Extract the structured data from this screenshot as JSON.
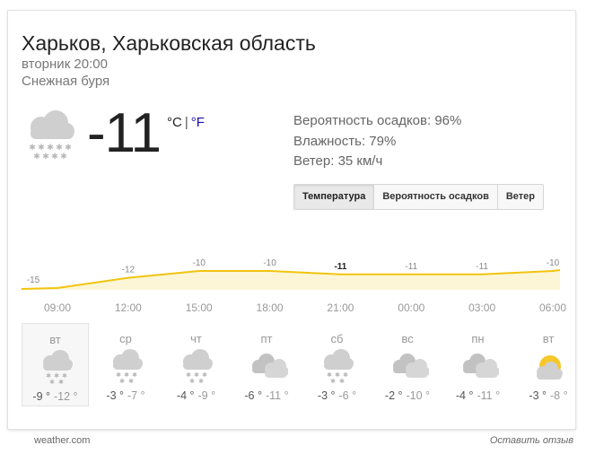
{
  "location": "Харьков, Харьковская область",
  "time": "вторник 20:00",
  "condition": "Снежная буря",
  "current": {
    "icon": "snow-cloud-icon",
    "temp": "-11",
    "unit_c": "°C",
    "unit_sep": "|",
    "unit_f": "°F"
  },
  "details": {
    "precip": "Вероятность осадков: 96%",
    "humidity": "Влажность: 79%",
    "wind": "Ветер: 35 км/ч"
  },
  "tabs": [
    {
      "label": "Температура",
      "active": true
    },
    {
      "label": "Вероятность осадков",
      "active": false
    },
    {
      "label": "Ветер",
      "active": false
    }
  ],
  "chart_data": {
    "type": "area",
    "x": [
      "09:00",
      "12:00",
      "15:00",
      "18:00",
      "21:00",
      "00:00",
      "03:00",
      "06:00"
    ],
    "values": [
      -15,
      -12,
      -10,
      -10,
      -11,
      -11,
      -11,
      -10
    ],
    "line_color": "#f1c40f",
    "fill_color": "#fdf6d6"
  },
  "forecast": [
    {
      "day": "вт",
      "icon": "snow-cloud-icon",
      "hi": "-9 °",
      "lo": "-12 °",
      "selected": true
    },
    {
      "day": "ср",
      "icon": "snow-cloud-icon",
      "hi": "-3 °",
      "lo": "-7 °",
      "selected": false
    },
    {
      "day": "чт",
      "icon": "snow-cloud-icon",
      "hi": "-4 °",
      "lo": "-9 °",
      "selected": false
    },
    {
      "day": "пт",
      "icon": "cloudy-icon",
      "hi": "-6 °",
      "lo": "-11 °",
      "selected": false
    },
    {
      "day": "сб",
      "icon": "snow-cloud-icon",
      "hi": "-3 °",
      "lo": "-6 °",
      "selected": false
    },
    {
      "day": "вс",
      "icon": "cloudy-icon",
      "hi": "-2 °",
      "lo": "-10 °",
      "selected": false
    },
    {
      "day": "пн",
      "icon": "cloudy-icon",
      "hi": "-4 °",
      "lo": "-11 °",
      "selected": false
    },
    {
      "day": "вт",
      "icon": "partly-sunny-icon",
      "hi": "-3 °",
      "lo": "-8 °",
      "selected": false
    }
  ],
  "footer": {
    "source": "weather.com",
    "feedback": "Оставить отзыв"
  }
}
